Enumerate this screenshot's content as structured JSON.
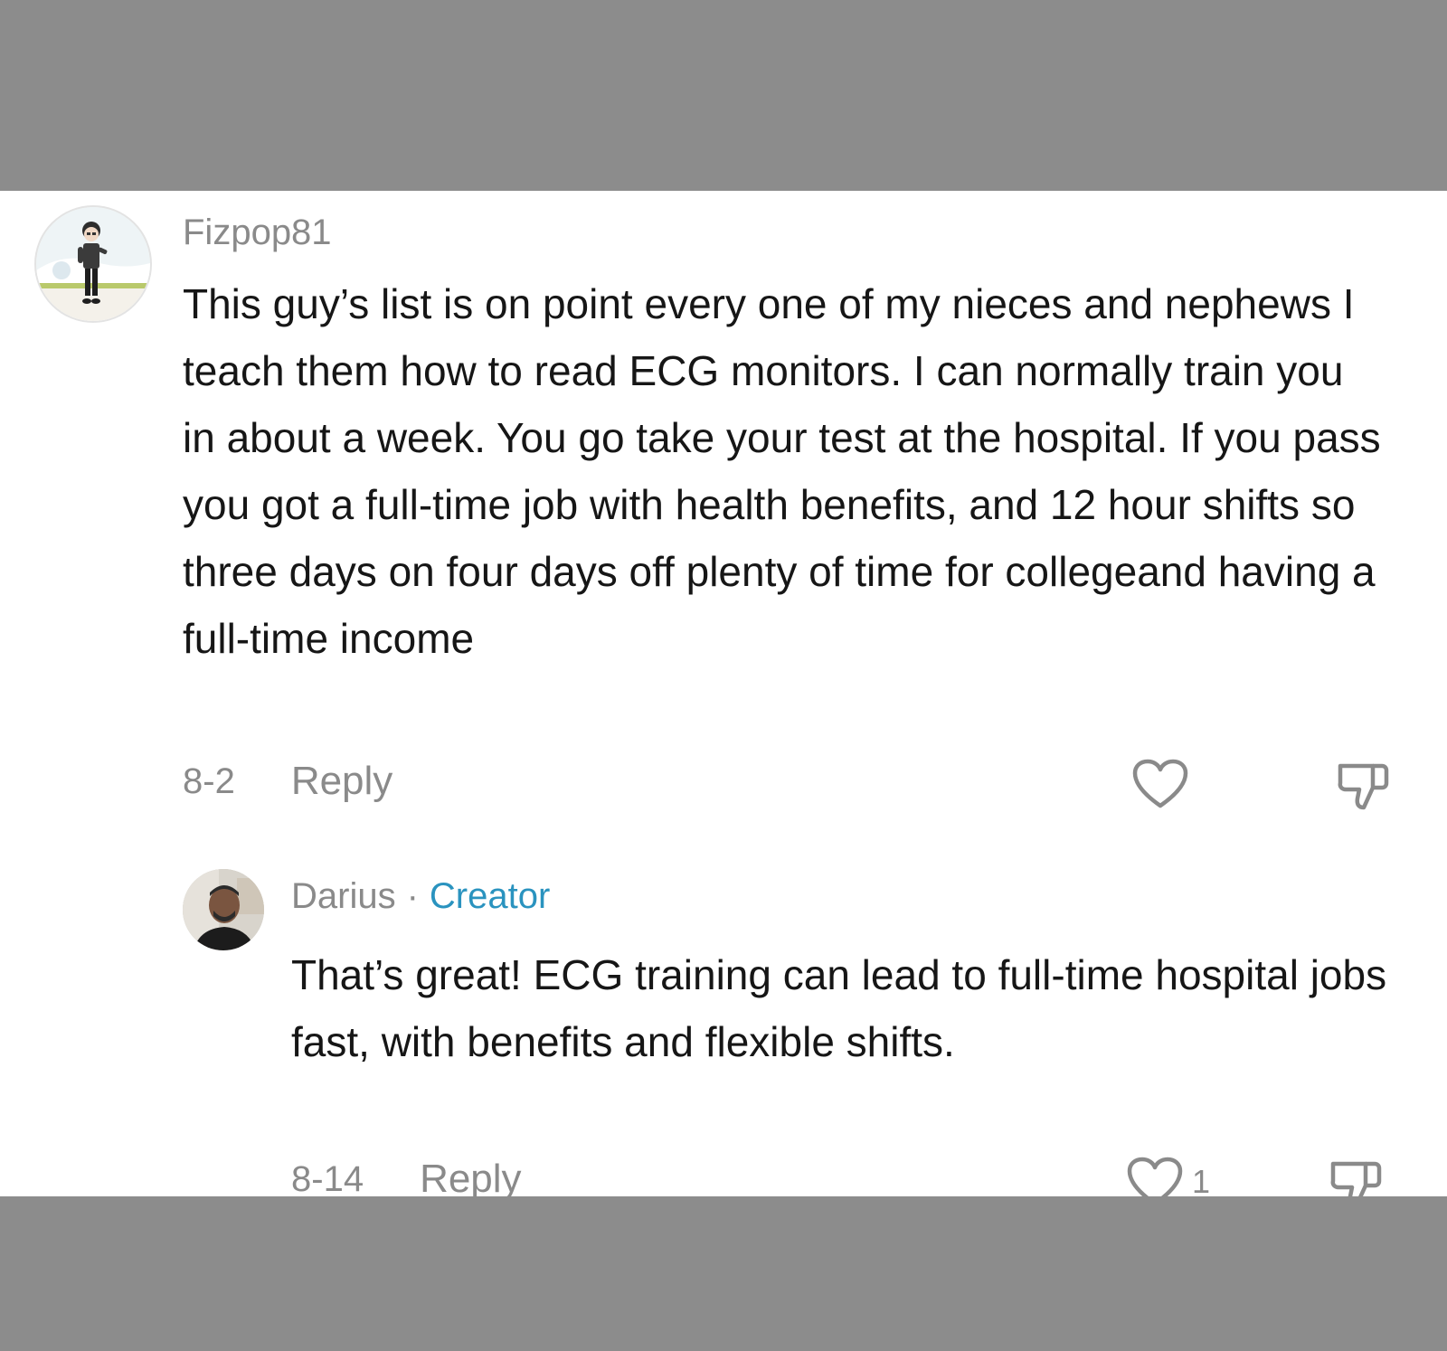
{
  "comments": [
    {
      "username": "Fizpop81",
      "text": "This guy’s list is on point every one of my nieces and nephews I teach them how to read ECG monitors. I can normally train you in about a week. You go take your test at the hospital. If you pass you got a full-time job with health benefits, and 12 hour shifts so three days on four days off plenty of time for collegeand having a full-time income",
      "date": "8-2",
      "reply_label": "Reply",
      "like_icon": "heart-outline-icon",
      "dislike_icon": "thumbs-down-outline-icon"
    },
    {
      "username": "Darius",
      "separator": "·",
      "badge": "Creator",
      "text": "That’s great! ECG training can lead to full-time hospital jobs fast, with benefits and flexible shifts.",
      "date": "8-14",
      "reply_label": "Reply",
      "like_count": "1",
      "like_icon": "heart-outline-icon",
      "dislike_icon": "thumbs-down-outline-icon"
    }
  ],
  "colors": {
    "background_band": "#8c8c8c",
    "panel": "#ffffff",
    "text": "#161616",
    "muted": "#8a8a8a",
    "creator_badge": "#2a93bf"
  }
}
